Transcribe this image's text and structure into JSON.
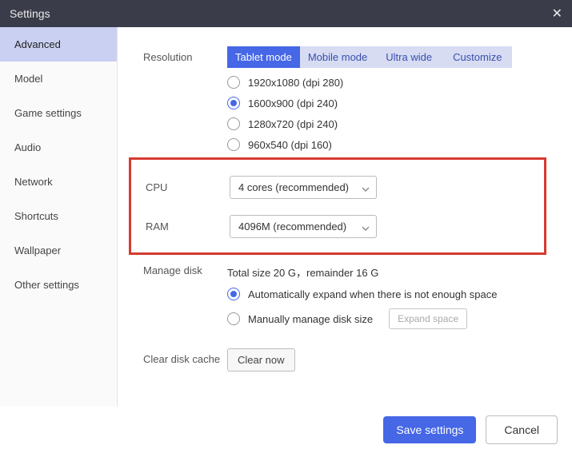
{
  "window": {
    "title": "Settings"
  },
  "sidebar": {
    "items": [
      {
        "label": "Advanced",
        "active": true
      },
      {
        "label": "Model"
      },
      {
        "label": "Game settings"
      },
      {
        "label": "Audio"
      },
      {
        "label": "Network"
      },
      {
        "label": "Shortcuts"
      },
      {
        "label": "Wallpaper"
      },
      {
        "label": "Other settings"
      }
    ]
  },
  "resolution": {
    "label": "Resolution",
    "tabs": [
      {
        "label": "Tablet mode",
        "active": true
      },
      {
        "label": "Mobile mode"
      },
      {
        "label": "Ultra wide"
      },
      {
        "label": "Customize"
      }
    ],
    "options": [
      {
        "label": "1920x1080  (dpi 280)",
        "checked": false
      },
      {
        "label": "1600x900  (dpi 240)",
        "checked": true
      },
      {
        "label": "1280x720  (dpi 240)",
        "checked": false
      },
      {
        "label": "960x540  (dpi 160)",
        "checked": false
      }
    ]
  },
  "cpu": {
    "label": "CPU",
    "value": "4 cores (recommended)"
  },
  "ram": {
    "label": "RAM",
    "value": "4096M (recommended)"
  },
  "disk": {
    "label": "Manage disk",
    "info": "Total size 20 G，remainder 16 G",
    "options": [
      {
        "label": "Automatically expand when there is not enough space",
        "checked": true
      },
      {
        "label": "Manually manage disk size",
        "checked": false
      }
    ],
    "expand_btn": "Expand space"
  },
  "cache": {
    "label": "Clear disk cache",
    "button": "Clear now"
  },
  "footer": {
    "save": "Save settings",
    "cancel": "Cancel"
  }
}
